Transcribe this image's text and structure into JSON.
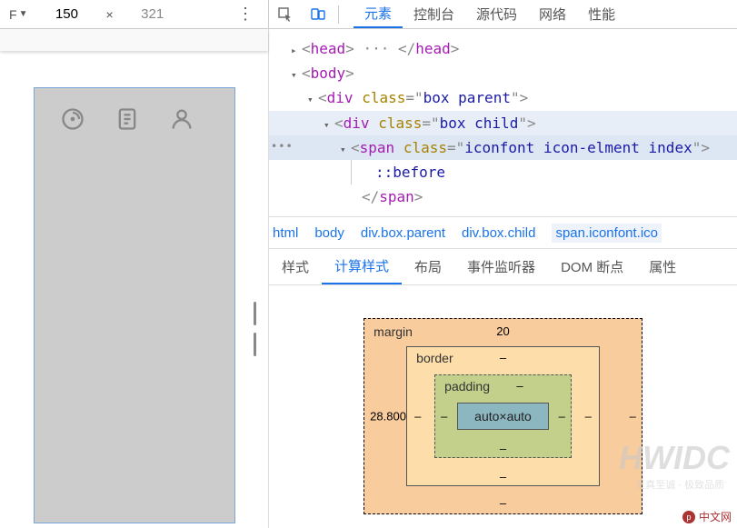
{
  "topbar": {
    "device_dropdown_glyph": "▸",
    "dim_width": "150",
    "dim_sep": "×",
    "dim_height": "321",
    "more": "⋮"
  },
  "panels": {
    "tabs": [
      "元素",
      "控制台",
      "源代码",
      "网络",
      "性能"
    ],
    "active": 0
  },
  "dom": {
    "lines": [
      {
        "indent": 24,
        "tri": "▸",
        "html": "<span class='bracket'>&lt;</span><span class='tag'>head</span><span class='bracket'>&gt;</span><span class='bracket'> ··· </span><span class='bracket'>&lt;/</span><span class='tag'>head</span><span class='bracket'>&gt;</span>"
      },
      {
        "indent": 24,
        "tri": "▾",
        "html": "<span class='bracket'>&lt;</span><span class='tag'>body</span><span class='bracket'>&gt;</span>"
      },
      {
        "indent": 42,
        "tri": "▾",
        "html": "<span class='bracket'>&lt;</span><span class='tag'>div</span> <span class='attr-name'>class</span><span class='bracket'>=&quot;</span><span class='attr-val'>box parent</span><span class='bracket'>&quot;&gt;</span>"
      },
      {
        "indent": 60,
        "tri": "▾",
        "html": "<span class='bracket'>&lt;</span><span class='tag'>div</span> <span class='attr-name'>class</span><span class='bracket'>=&quot;</span><span class='attr-val'>box child</span><span class='bracket'>&quot;&gt;</span>",
        "hlbg": "#e8eef8"
      },
      {
        "indent": 78,
        "tri": "▾",
        "html": "<span class='bracket'>&lt;</span><span class='tag'>span</span> <span class='attr-name'>class</span><span class='bracket'>=&quot;</span><span class='attr-val'>iconfont icon-elment index</span><span class='bracket'>&quot;&gt;</span>",
        "hl": true
      },
      {
        "indent": 108,
        "tri": "",
        "html": "<span class='pseudo'>::before</span>",
        "guide": true
      },
      {
        "indent": 90,
        "tri": "",
        "html": "<span class='bracket'>&lt;/</span><span class='tag'>span</span><span class='bracket'>&gt;</span>"
      }
    ]
  },
  "selected_dots": "•••",
  "breadcrumb": [
    "html",
    "body",
    "div.box.parent",
    "div.box.child",
    "span.iconfont.ico"
  ],
  "styles_tabs": [
    "样式",
    "计算样式",
    "布局",
    "事件监听器",
    "DOM 断点",
    "属性"
  ],
  "styles_active": 1,
  "boxmodel": {
    "margin_label": "margin",
    "border_label": "border",
    "padding_label": "padding",
    "content": "auto×auto",
    "margin_top": "20",
    "margin_left": "28.800",
    "dash": "–"
  },
  "watermark": "HWIDC",
  "watermark_sub": "至真至诚 · 极致品质",
  "logo_text": "中文网",
  "logo_glyph": "p"
}
